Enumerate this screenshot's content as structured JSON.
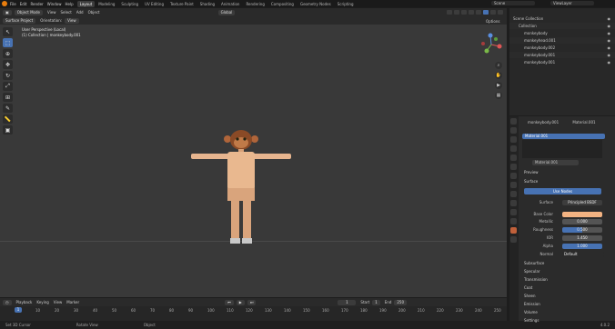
{
  "topbar": {
    "menus": [
      "File",
      "Edit",
      "Render",
      "Window",
      "Help"
    ],
    "workspaces": [
      "Layout",
      "Modeling",
      "Sculpting",
      "UV Editing",
      "Texture Paint",
      "Shading",
      "Animation",
      "Rendering",
      "Compositing",
      "Geometry Nodes",
      "Scripting"
    ],
    "scene": "Scene",
    "view_layer": "ViewLayer"
  },
  "viewport_header": {
    "mode": "Object Mode",
    "menus": [
      "View",
      "Select",
      "Add",
      "Object"
    ],
    "transform": "Global"
  },
  "tool_header": {
    "selector": "Surface Project",
    "orientation_label": "Orientation:",
    "orientation_value": "View",
    "options": "Options"
  },
  "viewport_info": {
    "line1": "User Perspective (Local)",
    "line2": "(1) Collection | monkeybody.001"
  },
  "timeline": {
    "menus": [
      "Playback",
      "Keying",
      "View",
      "Marker"
    ],
    "current_frame": "1",
    "start_label": "Start",
    "start": "1",
    "end_label": "End",
    "end": "250",
    "ticks": [
      "0",
      "10",
      "20",
      "30",
      "40",
      "50",
      "60",
      "70",
      "80",
      "90",
      "100",
      "110",
      "120",
      "130",
      "140",
      "150",
      "160",
      "170",
      "180",
      "190",
      "200",
      "210",
      "220",
      "230",
      "240",
      "250"
    ]
  },
  "statusbar": {
    "items": [
      "Set 3D Cursor",
      "Rotate View",
      "Object"
    ],
    "version": "4.0.2"
  },
  "outliner": {
    "rows": [
      {
        "label": "Scene Collection",
        "indent": 0
      },
      {
        "label": "Collection",
        "indent": 1
      },
      {
        "label": "monkeybody",
        "indent": 2
      },
      {
        "label": "monkeyhead.001",
        "indent": 2
      },
      {
        "label": "monkeybody.002",
        "indent": 2
      },
      {
        "label": "monkeybody.001",
        "indent": 2
      },
      {
        "label": "monkeybody.001",
        "indent": 2
      }
    ]
  },
  "properties": {
    "object": "monkeybody.001",
    "material": "Material.001",
    "slot": "Material.001",
    "preview": "Preview",
    "surface": "Surface",
    "use_nodes": "Use Nodes",
    "fields": [
      {
        "label": "Surface",
        "value": "Principled BSDF"
      },
      {
        "label": "Base Color",
        "value": ""
      },
      {
        "label": "Metallic",
        "value": "0.000"
      },
      {
        "label": "Roughness",
        "value": "0.500"
      },
      {
        "label": "IOR",
        "value": "1.450"
      },
      {
        "label": "Alpha",
        "value": "1.000"
      },
      {
        "label": "Normal",
        "value": "Default"
      }
    ],
    "sections": [
      "Subsurface",
      "Specular",
      "Transmission",
      "Coat",
      "Sheen",
      "Emission",
      "Volume",
      "Settings"
    ]
  },
  "colors": {
    "accent": "#4772b3",
    "skin": "#f0b682",
    "base_color_swatch": "#f3b382"
  }
}
